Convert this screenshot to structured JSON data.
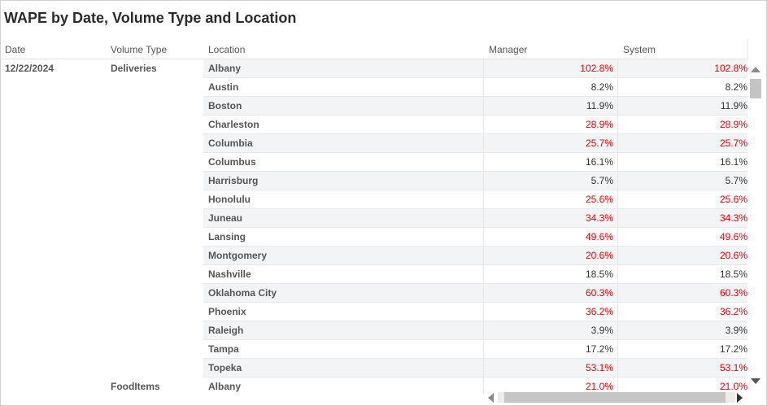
{
  "title": "WAPE by Date, Volume Type and Location",
  "headers": {
    "date": "Date",
    "volume_type": "Volume Type",
    "location": "Location",
    "manager": "Manager",
    "system": "System"
  },
  "date": "12/22/2024",
  "volume_types": [
    "Deliveries",
    "FoodItems"
  ],
  "status_colors": {
    "over_threshold": "#e0000b",
    "normal": "#333333"
  },
  "rows": [
    {
      "location": "Albany",
      "manager": "102.8%",
      "system": "102.8%",
      "flag": "red"
    },
    {
      "location": "Austin",
      "manager": "8.2%",
      "system": "8.2%",
      "flag": "dark"
    },
    {
      "location": "Boston",
      "manager": "11.9%",
      "system": "11.9%",
      "flag": "dark"
    },
    {
      "location": "Charleston",
      "manager": "28.9%",
      "system": "28.9%",
      "flag": "red"
    },
    {
      "location": "Columbia",
      "manager": "25.7%",
      "system": "25.7%",
      "flag": "red"
    },
    {
      "location": "Columbus",
      "manager": "16.1%",
      "system": "16.1%",
      "flag": "dark"
    },
    {
      "location": "Harrisburg",
      "manager": "5.7%",
      "system": "5.7%",
      "flag": "dark"
    },
    {
      "location": "Honolulu",
      "manager": "25.6%",
      "system": "25.6%",
      "flag": "red"
    },
    {
      "location": "Juneau",
      "manager": "34.3%",
      "system": "34.3%",
      "flag": "red"
    },
    {
      "location": "Lansing",
      "manager": "49.6%",
      "system": "49.6%",
      "flag": "red"
    },
    {
      "location": "Montgomery",
      "manager": "20.6%",
      "system": "20.6%",
      "flag": "red"
    },
    {
      "location": "Nashville",
      "manager": "18.5%",
      "system": "18.5%",
      "flag": "dark"
    },
    {
      "location": "Oklahoma City",
      "manager": "60.3%",
      "system": "60.3%",
      "flag": "red"
    },
    {
      "location": "Phoenix",
      "manager": "36.2%",
      "system": "36.2%",
      "flag": "red"
    },
    {
      "location": "Raleigh",
      "manager": "3.9%",
      "system": "3.9%",
      "flag": "dark"
    },
    {
      "location": "Tampa",
      "manager": "17.2%",
      "system": "17.2%",
      "flag": "dark"
    },
    {
      "location": "Topeka",
      "manager": "53.1%",
      "system": "53.1%",
      "flag": "red"
    },
    {
      "location": "Albany",
      "manager": "21.0%",
      "system": "21.0%",
      "flag": "red"
    }
  ]
}
